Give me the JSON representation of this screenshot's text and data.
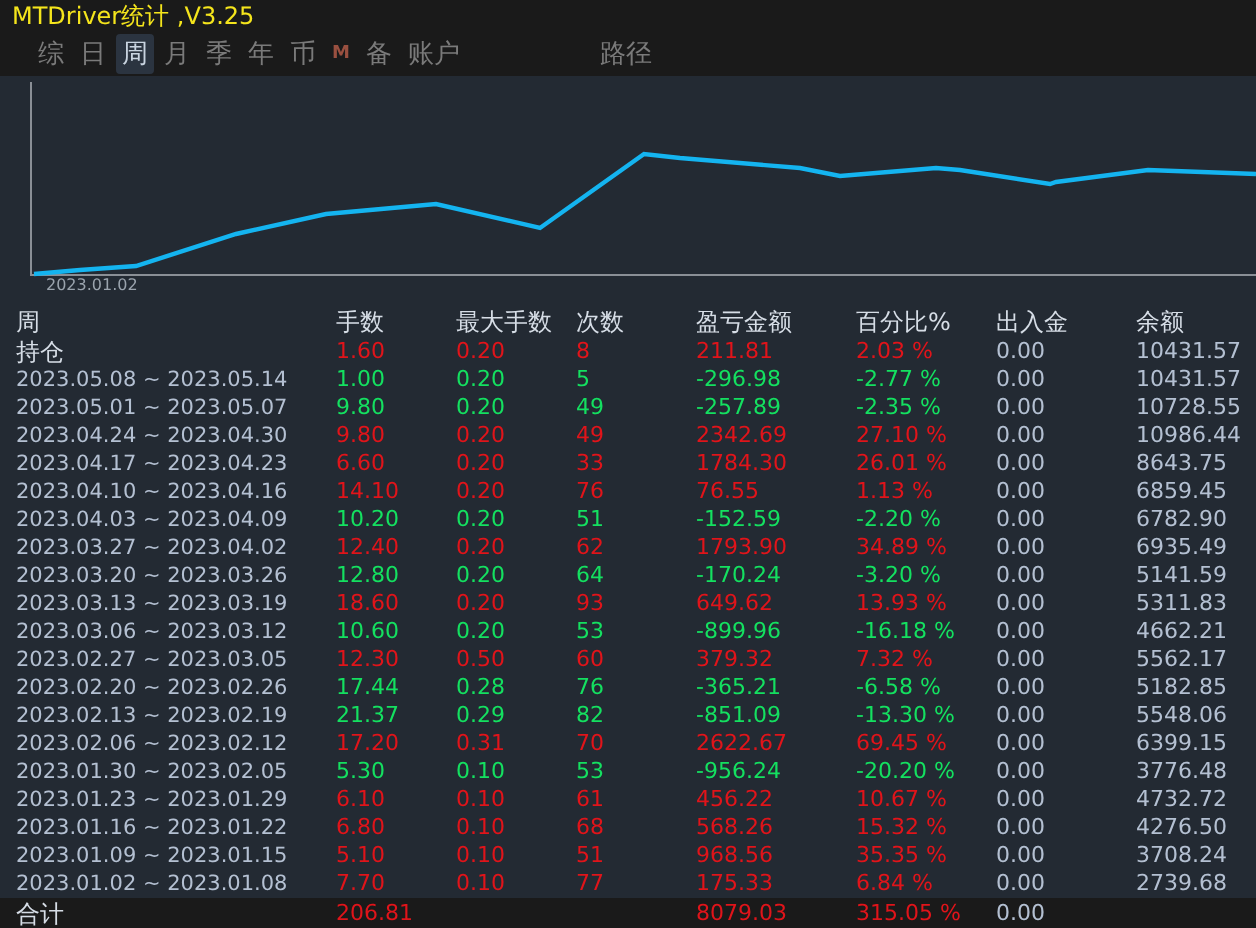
{
  "window": {
    "title": "MTDriver统计 ,V3.25"
  },
  "tabs": [
    {
      "label": "综",
      "selected": false,
      "kind": "text"
    },
    {
      "label": "日",
      "selected": false,
      "kind": "text"
    },
    {
      "label": "周",
      "selected": true,
      "kind": "text"
    },
    {
      "label": "月",
      "selected": false,
      "kind": "text"
    },
    {
      "label": "季",
      "selected": false,
      "kind": "text"
    },
    {
      "label": "年",
      "selected": false,
      "kind": "text"
    },
    {
      "label": "币",
      "selected": false,
      "kind": "text"
    },
    {
      "label": "M",
      "selected": false,
      "kind": "badge"
    },
    {
      "label": "备",
      "selected": false,
      "kind": "text"
    },
    {
      "label": "账户",
      "selected": false,
      "kind": "text"
    },
    {
      "label": "路径",
      "selected": false,
      "kind": "far"
    }
  ],
  "chart": {
    "x_label": "2023.01.02"
  },
  "table": {
    "columns": [
      "周",
      "手数",
      "最大手数",
      "次数",
      "盈亏金额",
      "百分比%",
      "出入金",
      "余额"
    ],
    "rows": [
      {
        "cells": [
          "持仓",
          "1.60",
          "0.20",
          "8",
          "211.81",
          "2.03 %",
          "0.00",
          "10431.57"
        ],
        "profit": true
      },
      {
        "cells": [
          "2023.05.08 ~ 2023.05.14",
          "1.00",
          "0.20",
          "5",
          "-296.98",
          "-2.77 %",
          "0.00",
          "10431.57"
        ],
        "profit": false
      },
      {
        "cells": [
          "2023.05.01 ~ 2023.05.07",
          "9.80",
          "0.20",
          "49",
          "-257.89",
          "-2.35 %",
          "0.00",
          "10728.55"
        ],
        "profit": false
      },
      {
        "cells": [
          "2023.04.24 ~ 2023.04.30",
          "9.80",
          "0.20",
          "49",
          "2342.69",
          "27.10 %",
          "0.00",
          "10986.44"
        ],
        "profit": true
      },
      {
        "cells": [
          "2023.04.17 ~ 2023.04.23",
          "6.60",
          "0.20",
          "33",
          "1784.30",
          "26.01 %",
          "0.00",
          "8643.75"
        ],
        "profit": true
      },
      {
        "cells": [
          "2023.04.10 ~ 2023.04.16",
          "14.10",
          "0.20",
          "76",
          "76.55",
          "1.13 %",
          "0.00",
          "6859.45"
        ],
        "profit": true
      },
      {
        "cells": [
          "2023.04.03 ~ 2023.04.09",
          "10.20",
          "0.20",
          "51",
          "-152.59",
          "-2.20 %",
          "0.00",
          "6782.90"
        ],
        "profit": false
      },
      {
        "cells": [
          "2023.03.27 ~ 2023.04.02",
          "12.40",
          "0.20",
          "62",
          "1793.90",
          "34.89 %",
          "0.00",
          "6935.49"
        ],
        "profit": true
      },
      {
        "cells": [
          "2023.03.20 ~ 2023.03.26",
          "12.80",
          "0.20",
          "64",
          "-170.24",
          "-3.20 %",
          "0.00",
          "5141.59"
        ],
        "profit": false
      },
      {
        "cells": [
          "2023.03.13 ~ 2023.03.19",
          "18.60",
          "0.20",
          "93",
          "649.62",
          "13.93 %",
          "0.00",
          "5311.83"
        ],
        "profit": true
      },
      {
        "cells": [
          "2023.03.06 ~ 2023.03.12",
          "10.60",
          "0.20",
          "53",
          "-899.96",
          "-16.18 %",
          "0.00",
          "4662.21"
        ],
        "profit": false
      },
      {
        "cells": [
          "2023.02.27 ~ 2023.03.05",
          "12.30",
          "0.50",
          "60",
          "379.32",
          "7.32 %",
          "0.00",
          "5562.17"
        ],
        "profit": true
      },
      {
        "cells": [
          "2023.02.20 ~ 2023.02.26",
          "17.44",
          "0.28",
          "76",
          "-365.21",
          "-6.58 %",
          "0.00",
          "5182.85"
        ],
        "profit": false
      },
      {
        "cells": [
          "2023.02.13 ~ 2023.02.19",
          "21.37",
          "0.29",
          "82",
          "-851.09",
          "-13.30 %",
          "0.00",
          "5548.06"
        ],
        "profit": false
      },
      {
        "cells": [
          "2023.02.06 ~ 2023.02.12",
          "17.20",
          "0.31",
          "70",
          "2622.67",
          "69.45 %",
          "0.00",
          "6399.15"
        ],
        "profit": true
      },
      {
        "cells": [
          "2023.01.30 ~ 2023.02.05",
          "5.30",
          "0.10",
          "53",
          "-956.24",
          "-20.20 %",
          "0.00",
          "3776.48"
        ],
        "profit": false
      },
      {
        "cells": [
          "2023.01.23 ~ 2023.01.29",
          "6.10",
          "0.10",
          "61",
          "456.22",
          "10.67 %",
          "0.00",
          "4732.72"
        ],
        "profit": true
      },
      {
        "cells": [
          "2023.01.16 ~ 2023.01.22",
          "6.80",
          "0.10",
          "68",
          "568.26",
          "15.32 %",
          "0.00",
          "4276.50"
        ],
        "profit": true
      },
      {
        "cells": [
          "2023.01.09 ~ 2023.01.15",
          "5.10",
          "0.10",
          "51",
          "968.56",
          "35.35 %",
          "0.00",
          "3708.24"
        ],
        "profit": true
      },
      {
        "cells": [
          "2023.01.02 ~ 2023.01.08",
          "7.70",
          "0.10",
          "77",
          "175.33",
          "6.84 %",
          "0.00",
          "2739.68"
        ],
        "profit": true
      }
    ],
    "total": {
      "cells": [
        "合计",
        "206.81",
        "",
        "",
        "8079.03",
        "315.05 %",
        "0.00",
        ""
      ],
      "profit": true
    }
  }
}
